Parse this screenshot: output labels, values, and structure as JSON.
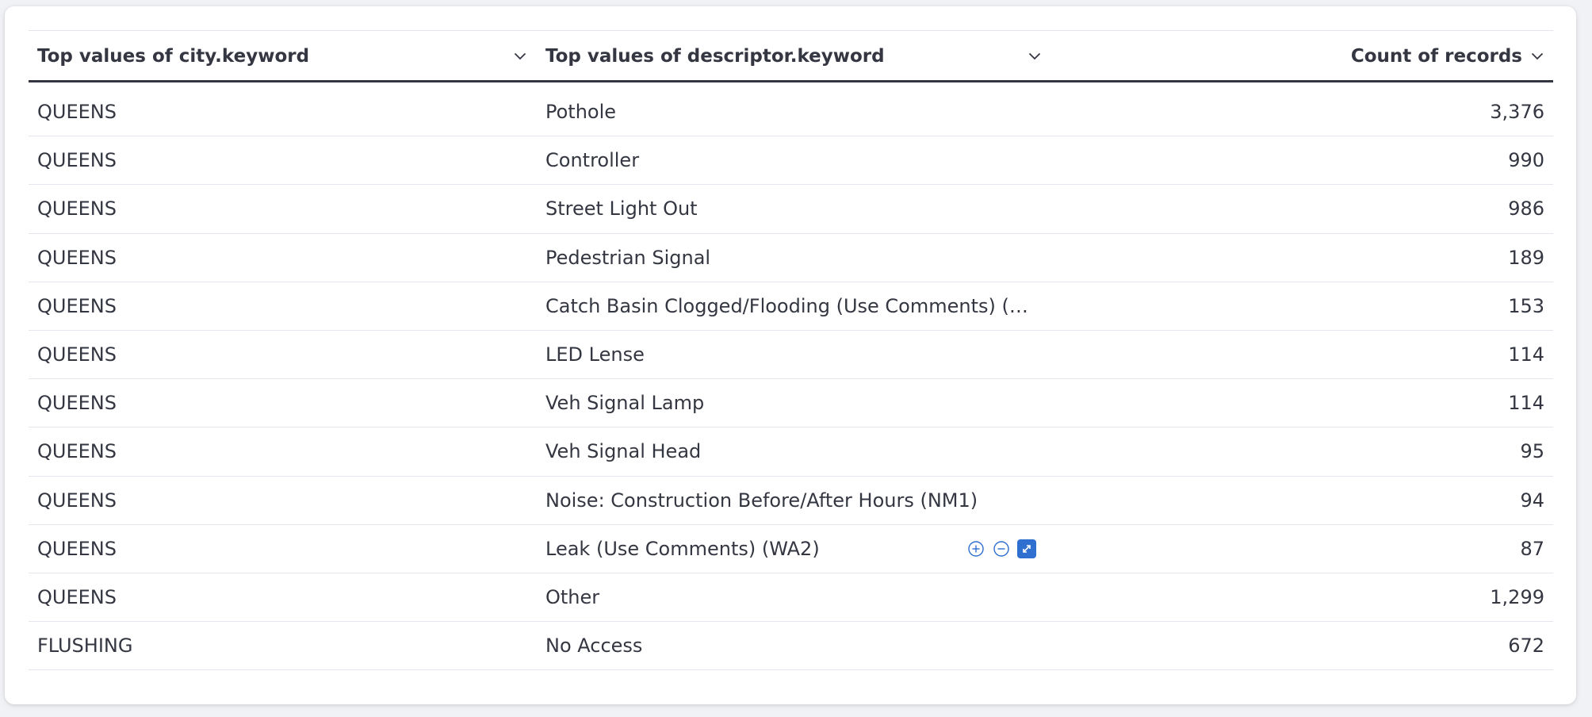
{
  "table": {
    "columns": [
      {
        "label": "Top values of city.keyword",
        "icon": "chevron-down-icon"
      },
      {
        "label": "Top values of descriptor.keyword",
        "icon": "chevron-down-icon"
      },
      {
        "label": "Count of records",
        "icon": "chevron-down-icon"
      }
    ],
    "rows": [
      {
        "city": "QUEENS",
        "descriptor": "Pothole",
        "count": "3,376"
      },
      {
        "city": "QUEENS",
        "descriptor": "Controller",
        "count": "990"
      },
      {
        "city": "QUEENS",
        "descriptor": "Street Light Out",
        "count": "986"
      },
      {
        "city": "QUEENS",
        "descriptor": "Pedestrian Signal",
        "count": "189"
      },
      {
        "city": "QUEENS",
        "descriptor": "Catch Basin Clogged/Flooding (Use Comments) (…",
        "count": "153"
      },
      {
        "city": "QUEENS",
        "descriptor": "LED Lense",
        "count": "114"
      },
      {
        "city": "QUEENS",
        "descriptor": "Veh Signal Lamp",
        "count": "114"
      },
      {
        "city": "QUEENS",
        "descriptor": "Veh Signal Head",
        "count": "95"
      },
      {
        "city": "QUEENS",
        "descriptor": "Noise: Construction Before/After Hours (NM1)",
        "count": "94"
      },
      {
        "city": "QUEENS",
        "descriptor": "Leak (Use Comments) (WA2)",
        "count": "87"
      },
      {
        "city": "QUEENS",
        "descriptor": "Other",
        "count": "1,299"
      },
      {
        "city": "FLUSHING",
        "descriptor": "No Access",
        "count": "672"
      }
    ],
    "hover_row_actions": [
      "filter-in-icon",
      "filter-out-icon",
      "expand-icon"
    ]
  },
  "colors": {
    "text": "#343741",
    "header_border": "#343741",
    "row_border": "#e3e6ec",
    "accent": "#2f6fd0",
    "background": "#f1f2f5",
    "panel": "#ffffff"
  }
}
